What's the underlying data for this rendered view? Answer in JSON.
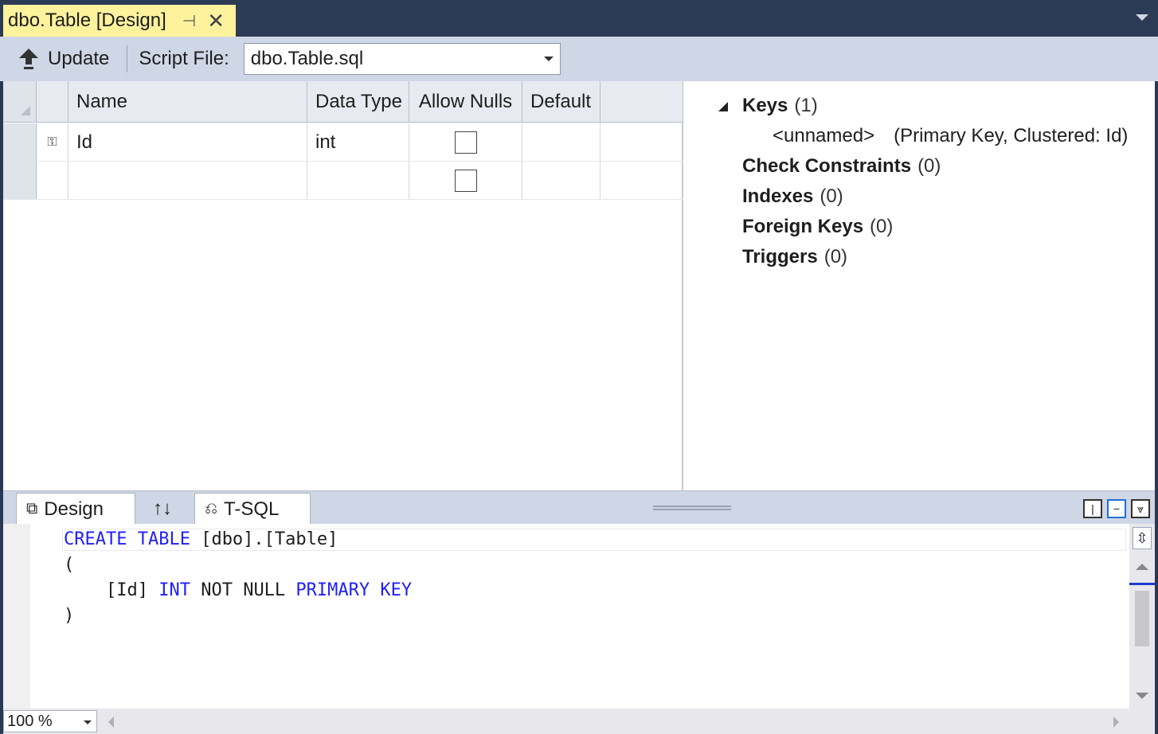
{
  "document_tab": {
    "title": "dbo.Table [Design]",
    "pin_icon": "pin-icon",
    "close_icon": "close-icon"
  },
  "toolbar": {
    "update_label": "Update",
    "script_file_label": "Script File:",
    "script_file_value": "dbo.Table.sql"
  },
  "grid": {
    "columns": [
      "Name",
      "Data Type",
      "Allow Nulls",
      "Default"
    ],
    "rows": [
      {
        "is_primary_key": true,
        "name": "Id",
        "data_type": "int",
        "allow_nulls": false,
        "default": ""
      },
      {
        "is_primary_key": false,
        "name": "",
        "data_type": "",
        "allow_nulls": false,
        "default": ""
      }
    ]
  },
  "properties": {
    "keys": {
      "label": "Keys",
      "count": "(1)",
      "child_name": "<unnamed>",
      "child_detail": "(Primary Key, Clustered: Id)"
    },
    "check_constraints": {
      "label": "Check Constraints",
      "count": "(0)"
    },
    "indexes": {
      "label": "Indexes",
      "count": "(0)"
    },
    "foreign_keys": {
      "label": "Foreign Keys",
      "count": "(0)"
    },
    "triggers": {
      "label": "Triggers",
      "count": "(0)"
    }
  },
  "pane_tabs": {
    "design_label": "Design",
    "swap_label": "↑↓",
    "tsql_label": "T-SQL"
  },
  "code": {
    "line1": {
      "kw": "CREATE TABLE",
      "rest": " [dbo].[Table]"
    },
    "line2": "(",
    "line3": {
      "pre": "    [Id] ",
      "kw1": "INT",
      "mid": " NOT NULL ",
      "kw2": "PRIMARY KEY"
    },
    "line4": ")"
  },
  "status": {
    "zoom": "100 %"
  },
  "colors": {
    "tab_active": "#fff29d",
    "chrome": "#cfd6e5",
    "title_bar": "#2b3b55",
    "keyword": "#1f1fff"
  }
}
